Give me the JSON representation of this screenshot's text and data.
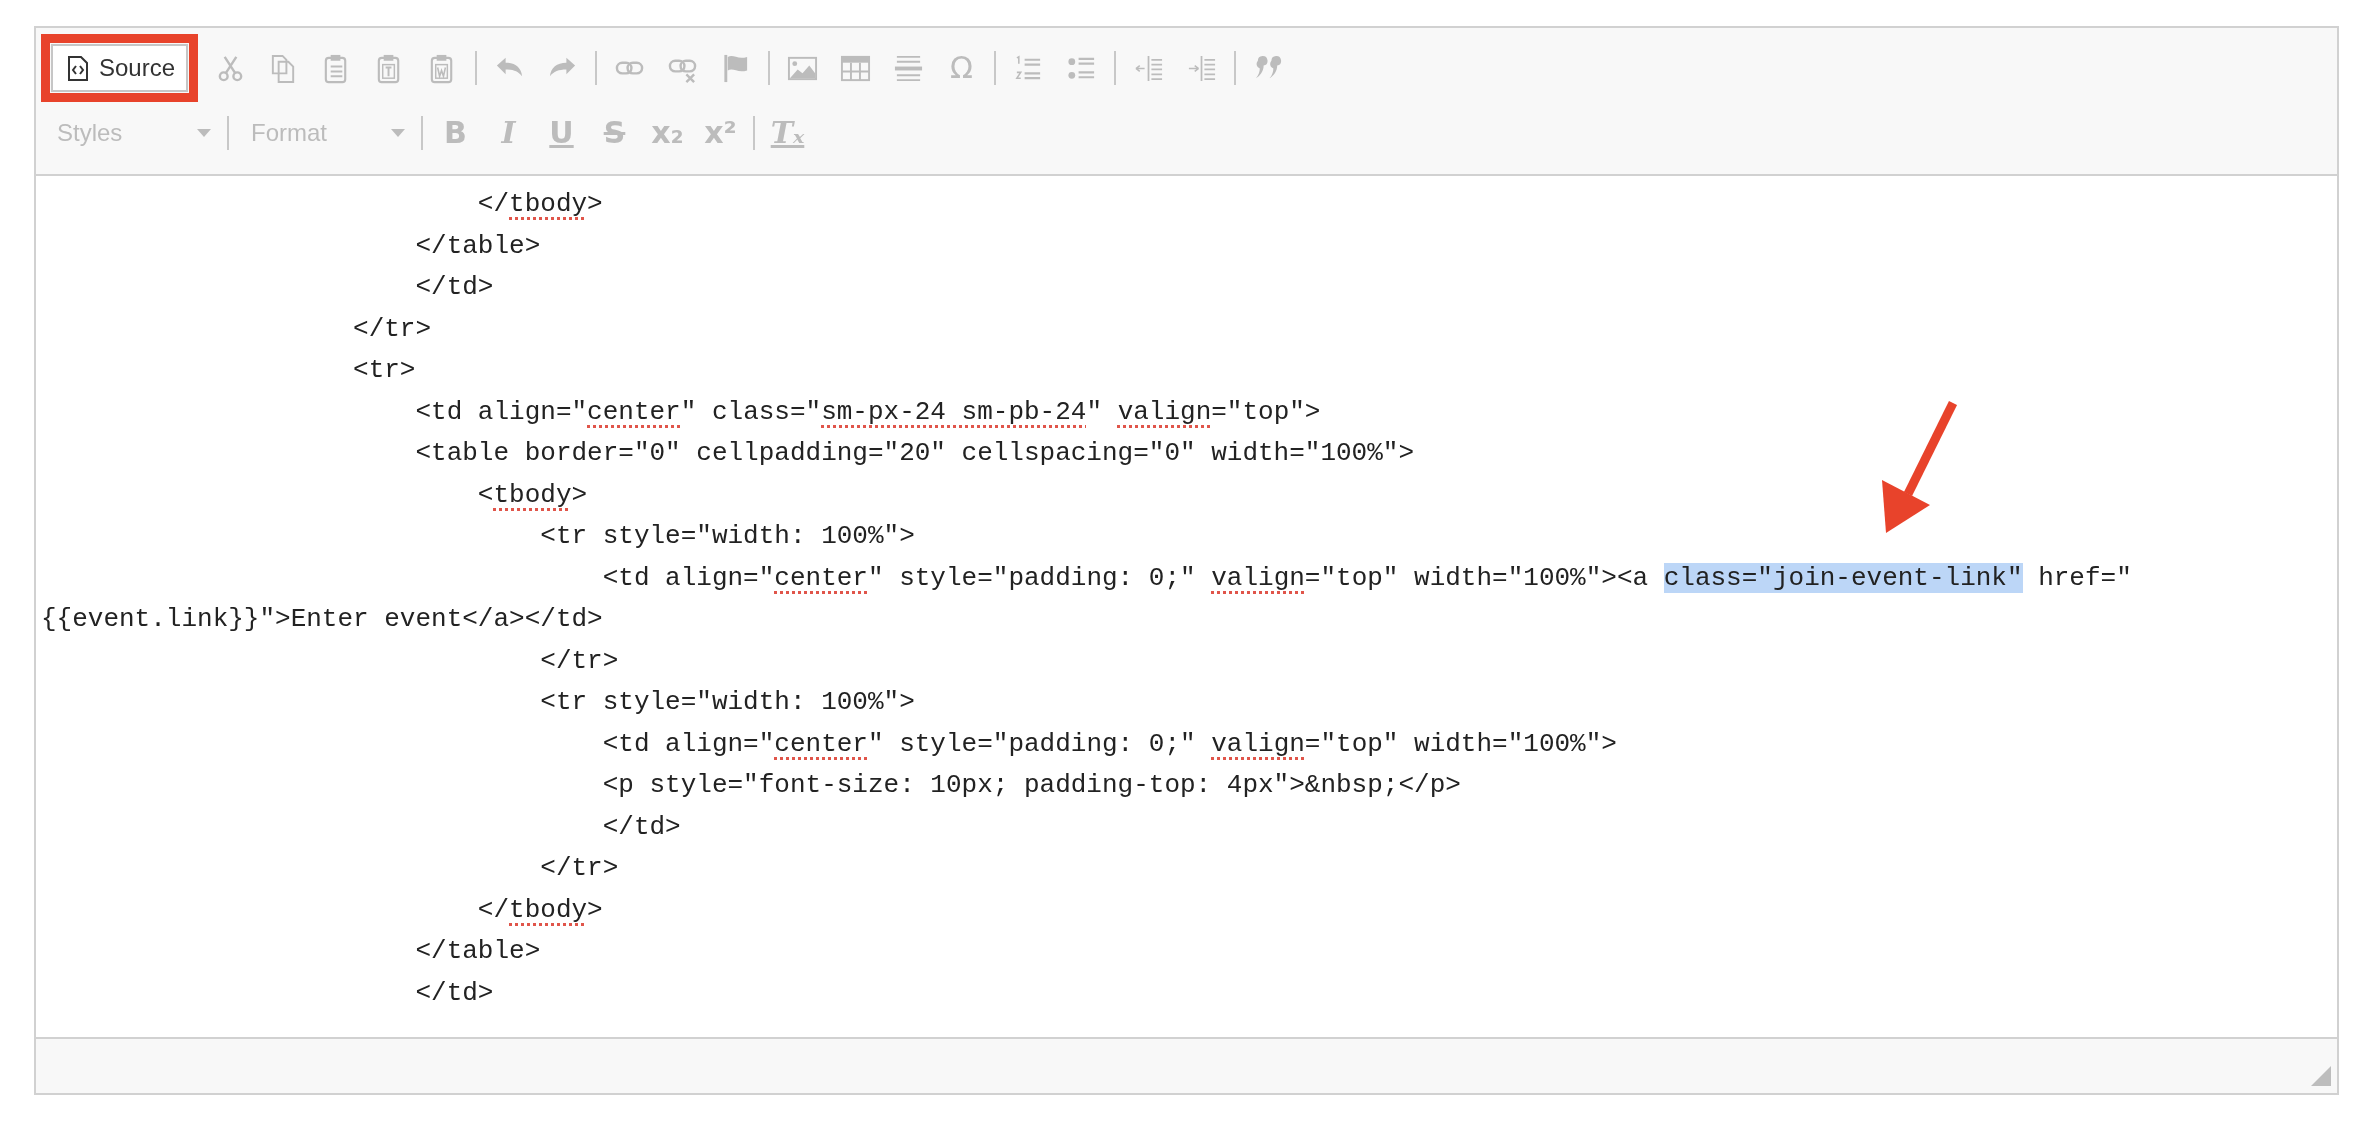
{
  "toolbar": {
    "rows": [
      {
        "groups": [
          {
            "items": [
              {
                "kind": "source",
                "label": "Source",
                "disabled": false
              },
              {
                "kind": "cut",
                "disabled": true
              },
              {
                "kind": "copy",
                "disabled": true
              },
              {
                "kind": "paste",
                "disabled": true
              },
              {
                "kind": "paste-text",
                "disabled": true
              },
              {
                "kind": "paste-word",
                "disabled": true
              }
            ]
          },
          {
            "items": [
              {
                "kind": "undo",
                "disabled": true
              },
              {
                "kind": "redo",
                "disabled": true
              }
            ]
          },
          {
            "items": [
              {
                "kind": "link",
                "disabled": true
              },
              {
                "kind": "unlink",
                "disabled": true
              },
              {
                "kind": "anchor",
                "disabled": true
              }
            ]
          },
          {
            "items": [
              {
                "kind": "image",
                "disabled": true
              },
              {
                "kind": "table",
                "disabled": true
              },
              {
                "kind": "rule",
                "disabled": true
              },
              {
                "kind": "special-char",
                "glyph": "Ω",
                "disabled": true
              }
            ]
          },
          {
            "items": [
              {
                "kind": "numbered-list",
                "disabled": true
              },
              {
                "kind": "bulleted-list",
                "disabled": true
              }
            ]
          },
          {
            "items": [
              {
                "kind": "outdent",
                "disabled": true
              },
              {
                "kind": "indent",
                "disabled": true
              }
            ]
          },
          {
            "items": [
              {
                "kind": "quote",
                "disabled": true
              }
            ]
          }
        ]
      },
      {
        "groups": [
          {
            "items": [
              {
                "kind": "combo",
                "label": "Styles",
                "disabled": true
              }
            ]
          },
          {
            "items": [
              {
                "kind": "combo",
                "label": "Format",
                "disabled": true
              }
            ]
          },
          {
            "items": [
              {
                "kind": "bold",
                "glyph": "B",
                "disabled": true
              },
              {
                "kind": "italic",
                "glyph": "I",
                "disabled": true
              },
              {
                "kind": "underline",
                "glyph": "U",
                "disabled": true
              },
              {
                "kind": "strike",
                "glyph": "S",
                "disabled": true
              },
              {
                "kind": "subscript",
                "glyph": "x₂",
                "disabled": true
              },
              {
                "kind": "superscript",
                "glyph": "x²",
                "disabled": true
              }
            ]
          },
          {
            "items": [
              {
                "kind": "remove-format",
                "glyph": "Tₓ",
                "disabled": true
              }
            ]
          }
        ]
      }
    ]
  },
  "source_lines": [
    {
      "segments": [
        {
          "kind": "plain",
          "text": "                            </"
        },
        {
          "kind": "misspelled",
          "text": "tbody"
        },
        {
          "kind": "plain",
          "text": ">"
        }
      ]
    },
    {
      "segments": [
        {
          "kind": "plain",
          "text": "                        </table>"
        }
      ]
    },
    {
      "segments": [
        {
          "kind": "plain",
          "text": "                        </td>"
        }
      ]
    },
    {
      "segments": [
        {
          "kind": "plain",
          "text": "                    </tr>"
        }
      ]
    },
    {
      "segments": [
        {
          "kind": "plain",
          "text": "                    <tr>"
        }
      ]
    },
    {
      "segments": [
        {
          "kind": "plain",
          "text": "                        <td align=\""
        },
        {
          "kind": "misspelled",
          "text": "center"
        },
        {
          "kind": "plain",
          "text": "\" class=\""
        },
        {
          "kind": "misspelled",
          "text": "sm-px-24 sm-pb-24"
        },
        {
          "kind": "plain",
          "text": "\" "
        },
        {
          "kind": "misspelled",
          "text": "valign"
        },
        {
          "kind": "plain",
          "text": "=\"top\">"
        }
      ]
    },
    {
      "segments": [
        {
          "kind": "plain",
          "text": "                        <table border=\"0\" cellpadding=\"20\" cellspacing=\"0\" width=\"100%\">"
        }
      ]
    },
    {
      "segments": [
        {
          "kind": "plain",
          "text": "                            <"
        },
        {
          "kind": "misspelled",
          "text": "tbody"
        },
        {
          "kind": "plain",
          "text": ">"
        }
      ]
    },
    {
      "segments": [
        {
          "kind": "plain",
          "text": "                                <tr style=\"width: 100%\">"
        }
      ]
    },
    {
      "segments": [
        {
          "kind": "plain",
          "text": "                                    <td align=\""
        },
        {
          "kind": "misspelled",
          "text": "center"
        },
        {
          "kind": "plain",
          "text": "\" style=\"padding: 0;\" "
        },
        {
          "kind": "misspelled",
          "text": "valign"
        },
        {
          "kind": "plain",
          "text": "=\"top\" width=\"100%\"><a "
        },
        {
          "kind": "selected",
          "text": "class=\"join-event-link\""
        },
        {
          "kind": "plain",
          "text": " href=\""
        }
      ]
    },
    {
      "segments": [
        {
          "kind": "plain",
          "text": "{{event.link}}\">Enter event</a></td>"
        }
      ]
    },
    {
      "segments": [
        {
          "kind": "plain",
          "text": "                                </tr>"
        }
      ]
    },
    {
      "segments": [
        {
          "kind": "plain",
          "text": "                                <tr style=\"width: 100%\">"
        }
      ]
    },
    {
      "segments": [
        {
          "kind": "plain",
          "text": "                                    <td align=\""
        },
        {
          "kind": "misspelled",
          "text": "center"
        },
        {
          "kind": "plain",
          "text": "\" style=\"padding: 0;\" "
        },
        {
          "kind": "misspelled",
          "text": "valign"
        },
        {
          "kind": "plain",
          "text": "=\"top\" width=\"100%\">"
        }
      ]
    },
    {
      "segments": [
        {
          "kind": "plain",
          "text": "                                    <p style=\"font-size: 10px; padding-top: 4px\">&nbsp;</p>"
        }
      ]
    },
    {
      "segments": [
        {
          "kind": "plain",
          "text": "                                    </td>"
        }
      ]
    },
    {
      "segments": [
        {
          "kind": "plain",
          "text": "                                </tr>"
        }
      ]
    },
    {
      "segments": [
        {
          "kind": "plain",
          "text": "                            </"
        },
        {
          "kind": "misspelled",
          "text": "tbody"
        },
        {
          "kind": "plain",
          "text": ">"
        }
      ]
    },
    {
      "segments": [
        {
          "kind": "plain",
          "text": "                        </table>"
        }
      ]
    },
    {
      "segments": [
        {
          "kind": "plain",
          "text": "                        </td>"
        }
      ]
    }
  ],
  "callouts": {
    "source_outline": true,
    "arrow_to_selection": true
  }
}
